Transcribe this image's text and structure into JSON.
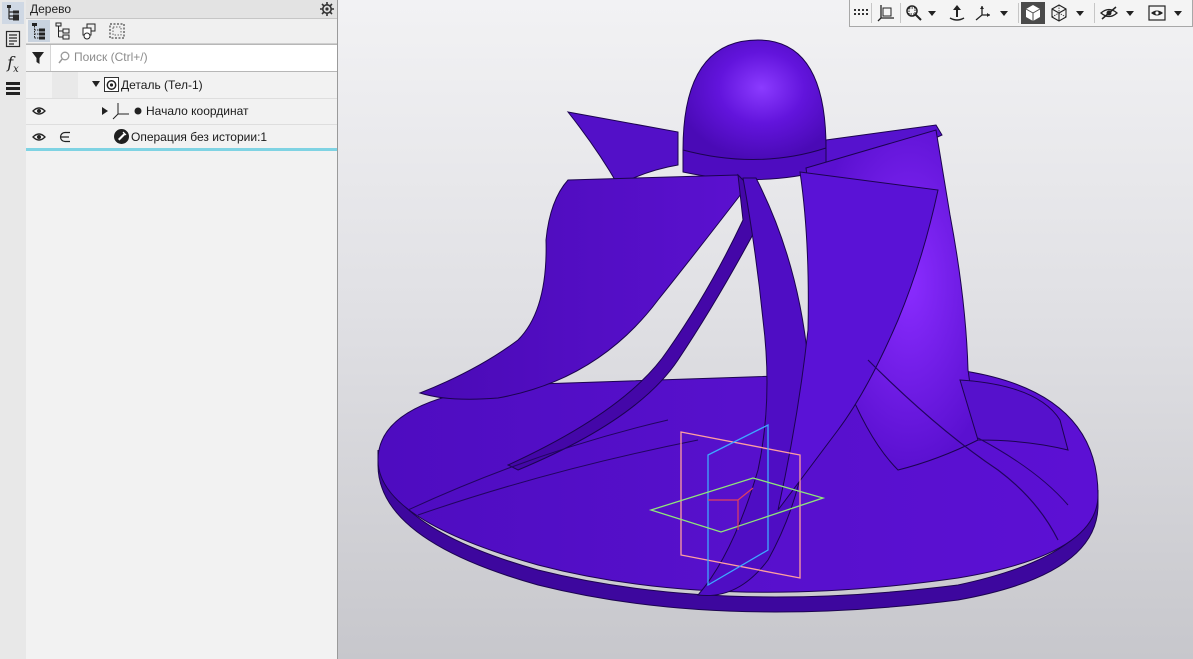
{
  "left_rail": {
    "items": [
      {
        "icon": "tree-icon",
        "active": true
      },
      {
        "icon": "properties-icon",
        "active": false
      },
      {
        "icon": "variables-icon",
        "glyph": "f",
        "sub": "x",
        "active": false
      },
      {
        "icon": "layers-icon",
        "active": false
      }
    ]
  },
  "panel": {
    "title": "Дерево",
    "search": {
      "placeholder": "Поиск (Ctrl+/)",
      "value": ""
    },
    "toolbar": [
      "tree-structure-icon",
      "tree-history-icon",
      "tree-links-icon",
      "tree-select-icon"
    ]
  },
  "tree": {
    "rows": [
      {
        "label": "Деталь (Тел-1)",
        "expanded": true,
        "visible": null
      },
      {
        "label": "Начало координат",
        "expanded": false,
        "visible": true
      },
      {
        "label": "Операция без истории:1",
        "visible": true,
        "included": true,
        "selected": true
      }
    ]
  },
  "view_toolbar": {
    "buttons": [
      "grid-icon",
      "orientation-icon",
      "zoom-icon",
      "rotate-icon",
      "axes-icon",
      "shaded-icon",
      "wireframe-icon",
      "hide-icon",
      "show-icon"
    ]
  },
  "colors": {
    "model": "#5a0fd0",
    "model_dark": "#3a0698",
    "model_light": "#7a22f0",
    "plane_xy": "#8fe67a",
    "plane_yz": "#3ea8ff",
    "plane_xz": "#ff9f9f",
    "selection": "#7fd3e3"
  }
}
